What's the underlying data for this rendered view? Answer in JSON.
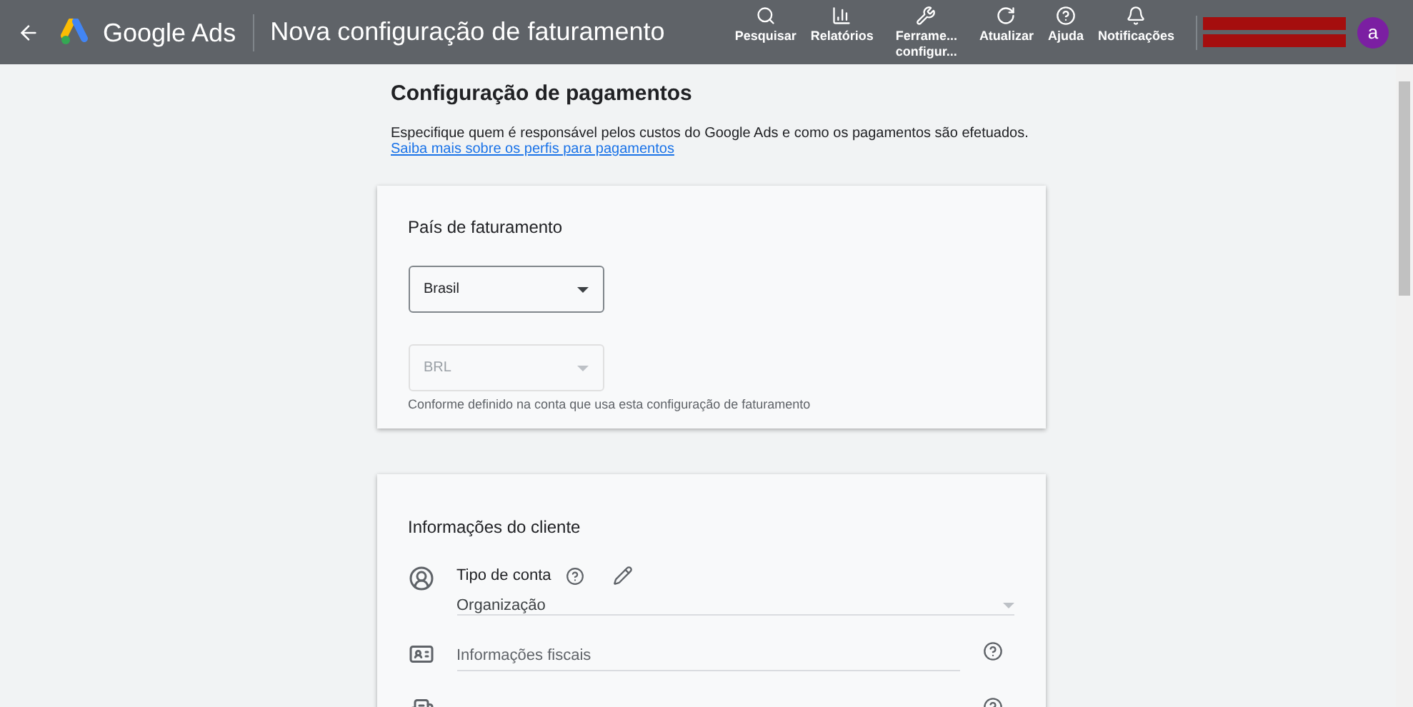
{
  "header": {
    "brand": "Google Ads",
    "title": "Nova configuração de faturamento"
  },
  "toolbar": [
    {
      "kind": "search",
      "label": "Pesquisar"
    },
    {
      "kind": "reports",
      "label": "Relatórios"
    },
    {
      "kind": "tools",
      "label": "Ferrame... configur..."
    },
    {
      "kind": "refresh",
      "label": "Atualizar"
    },
    {
      "kind": "help",
      "label": "Ajuda"
    },
    {
      "kind": "notifications",
      "label": "Notificações"
    }
  ],
  "account": {
    "avatar": "a"
  },
  "page": {
    "heading": "Configuração de pagamentos",
    "intro": "Especifique quem é responsável pelos custos do Google Ads e como os pagamentos são efetuados.",
    "link": "Saiba mais sobre os perfis para pagamentos"
  },
  "billing_country": {
    "title": "País de faturamento",
    "country": {
      "value": "Brasil",
      "disabled": false
    },
    "currency": {
      "value": "BRL",
      "disabled": true
    },
    "helper": "Conforme definido na conta que usa esta configuração de faturamento"
  },
  "customer_info": {
    "title": "Informações do cliente",
    "fields": [
      {
        "kind": "account_type",
        "label": "Tipo de conta",
        "value": "Organização"
      },
      {
        "kind": "tax_info",
        "placeholder": "Informações fiscais"
      },
      {
        "kind": "cut_off"
      }
    ]
  }
}
